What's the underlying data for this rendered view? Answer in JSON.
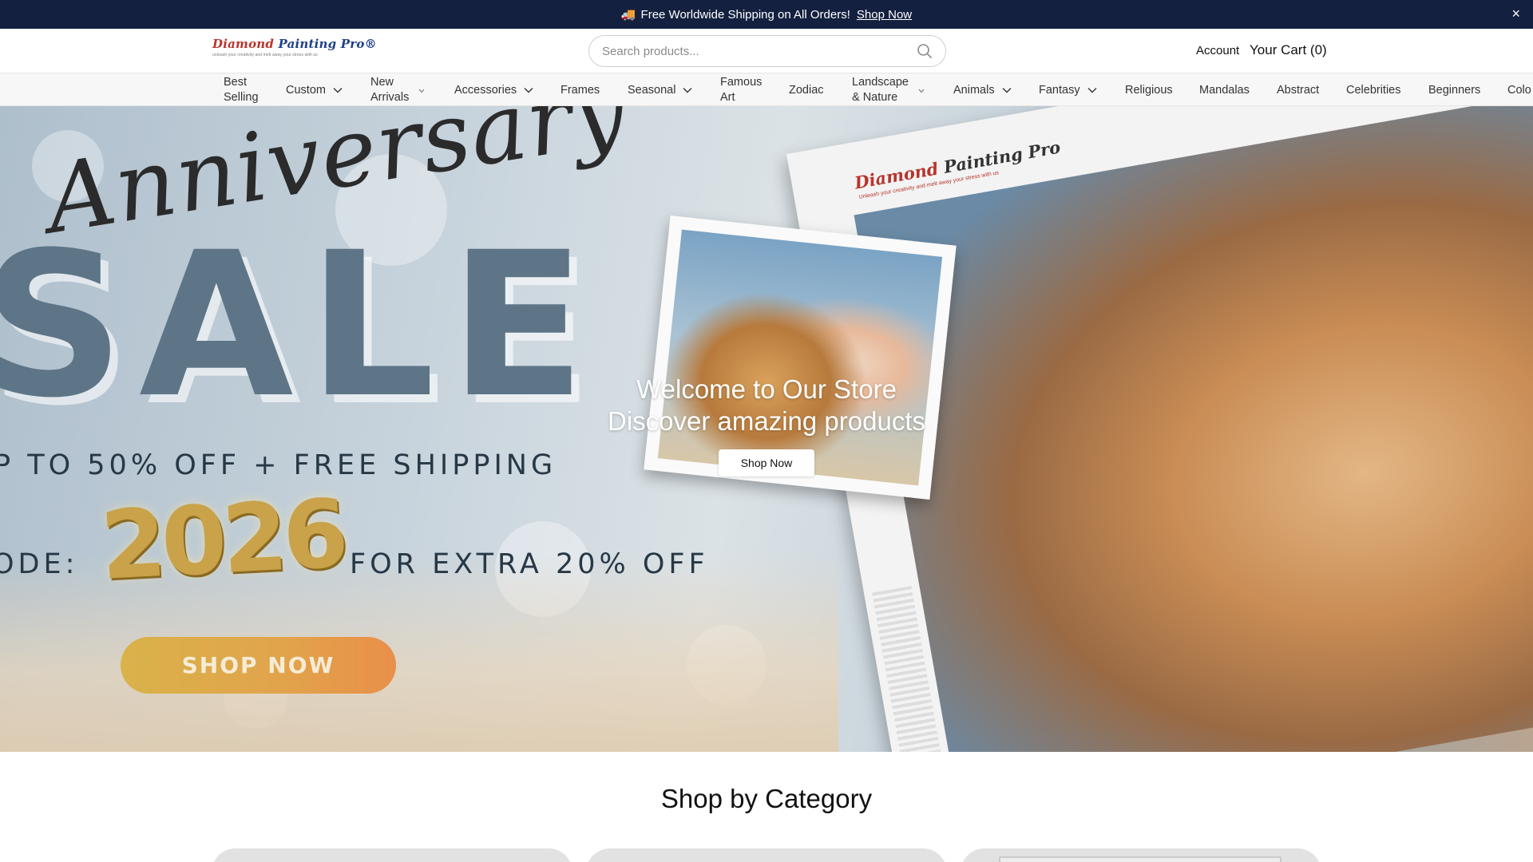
{
  "announcement": {
    "icon": "truck-icon",
    "text": "Free Worldwide Shipping on All Orders!",
    "link": "Shop Now",
    "close": "×"
  },
  "header": {
    "logo": {
      "part1": "Diamond ",
      "part2": "Painting Pro",
      "mark": "®",
      "tagline": "unleash your creativity and melt away your stress with us"
    },
    "search": {
      "placeholder": "Search products...",
      "icon": "search-icon"
    },
    "account": "Account",
    "cart": "Your Cart (0)"
  },
  "nav": {
    "items": [
      {
        "label": "Best\nSelling",
        "dropdown": false
      },
      {
        "label": "Custom",
        "dropdown": true
      },
      {
        "label": "New\nArrivals",
        "dropdown": true
      },
      {
        "label": "Accessories",
        "dropdown": true
      },
      {
        "label": "Frames",
        "dropdown": false
      },
      {
        "label": "Seasonal",
        "dropdown": true
      },
      {
        "label": "Famous\nArt",
        "dropdown": false
      },
      {
        "label": "Zodiac",
        "dropdown": false
      },
      {
        "label": "Landscape\n& Nature",
        "dropdown": true
      },
      {
        "label": "Animals",
        "dropdown": true
      },
      {
        "label": "Fantasy",
        "dropdown": true
      },
      {
        "label": "Religious",
        "dropdown": false
      },
      {
        "label": "Mandalas",
        "dropdown": false
      },
      {
        "label": "Abstract",
        "dropdown": false
      },
      {
        "label": "Celebrities",
        "dropdown": false
      },
      {
        "label": "Beginners",
        "dropdown": false
      },
      {
        "label": "Colo",
        "dropdown": false
      }
    ]
  },
  "hero": {
    "banner": {
      "script": "Anniversary",
      "headline": "SALE",
      "offer": "P TO 50% OFF + FREE SHIPPING",
      "code_prefix": "ODE:",
      "code": "2026",
      "code_suffix": "FOR EXTRA 20% OFF",
      "button": "SHOP NOW",
      "canvas_brand_1": "Diamond ",
      "canvas_brand_2": "Painting Pro",
      "canvas_tag": "Unleash your creativity and melt away your stress with us"
    },
    "title": "Welcome to Our Store",
    "subtitle": "Discover amazing products",
    "button": "Shop Now"
  },
  "categories": {
    "title": "Shop by Category"
  },
  "colors": {
    "announcement_bg": "#14203f",
    "nav_bg": "#f7f7f7",
    "sale_blue": "#5d7587",
    "gold": "#c9a24a"
  }
}
